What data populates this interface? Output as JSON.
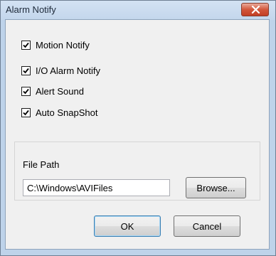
{
  "window": {
    "title": "Alarm Notify",
    "close_icon": "close-x-icon"
  },
  "options": [
    {
      "label": "Motion Notify",
      "checked": true
    },
    {
      "label": "I/O Alarm Notify",
      "checked": true
    },
    {
      "label": "Alert Sound",
      "checked": true
    },
    {
      "label": "Auto SnapShot",
      "checked": true
    }
  ],
  "file_path": {
    "label": "File Path",
    "value": "C:\\Windows\\AVIFiles",
    "browse_label": "Browse..."
  },
  "buttons": {
    "ok_label": "OK",
    "cancel_label": "Cancel"
  },
  "colors": {
    "frame": "#bed3ea",
    "close_button": "#c94a30",
    "client_bg": "#f0f0f0"
  }
}
